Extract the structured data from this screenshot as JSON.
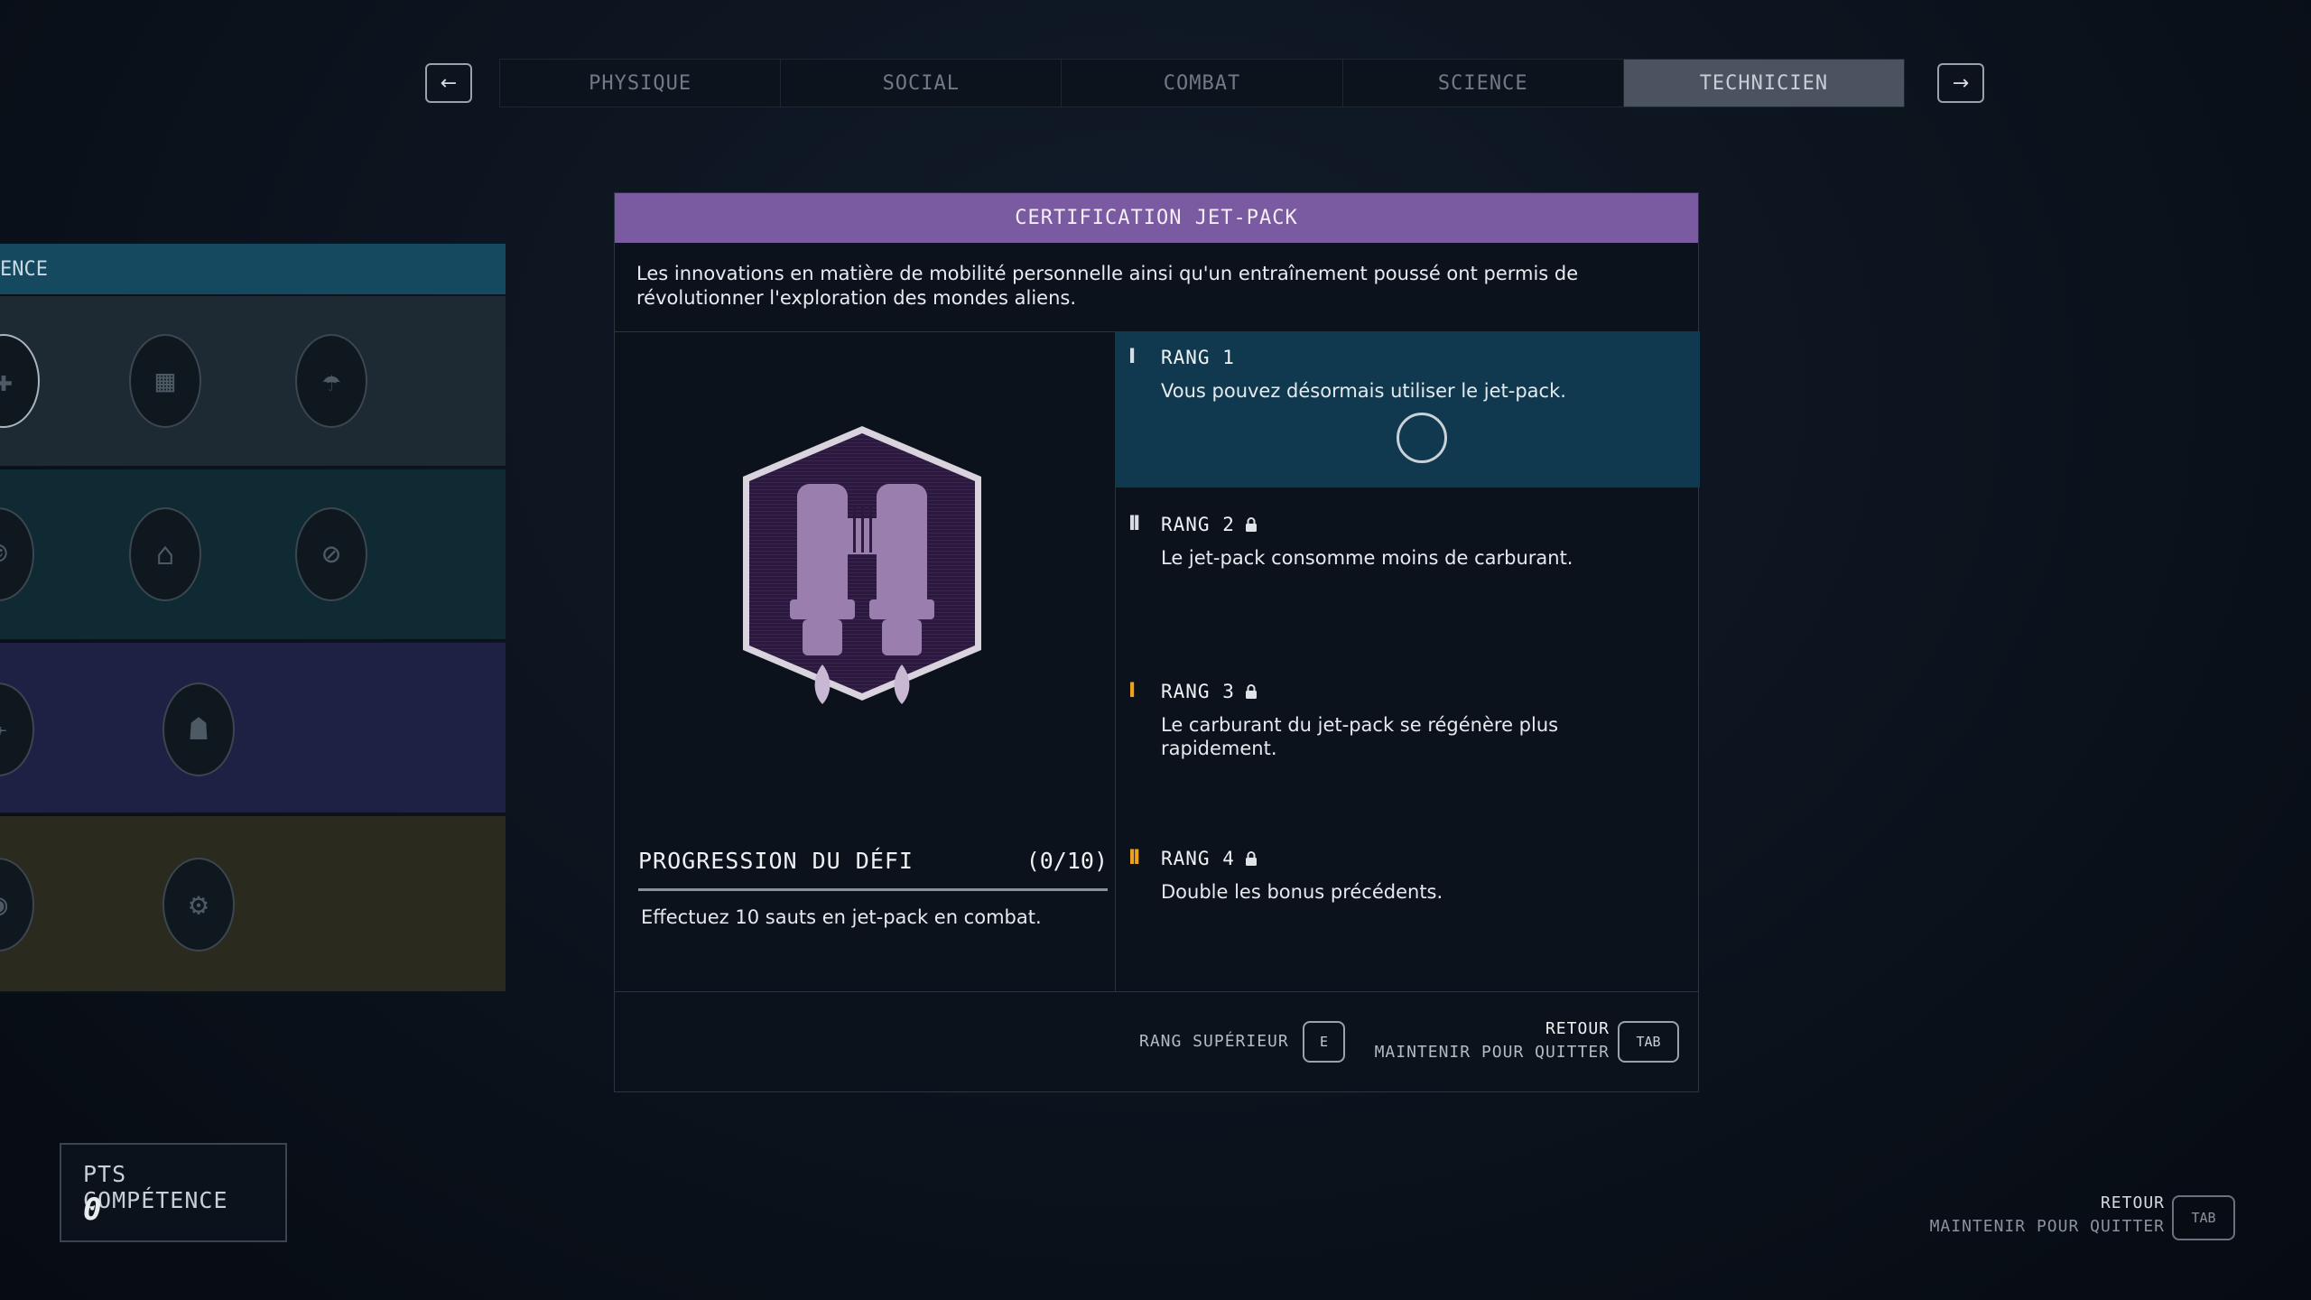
{
  "nav": {
    "prev_icon": "arrow-left-icon",
    "next_icon": "arrow-right-icon",
    "prev_glyph": "←",
    "next_glyph": "→",
    "tabs": [
      {
        "label": "PHYSIQUE",
        "active": false
      },
      {
        "label": "SOCIAL",
        "active": false
      },
      {
        "label": "COMBAT",
        "active": false
      },
      {
        "label": "SCIENCE",
        "active": false
      },
      {
        "label": "TECHNICIEN",
        "active": true
      }
    ]
  },
  "tree": {
    "header": "ENCE",
    "row_colors": [
      "#1e2a33",
      "#0f2a32",
      "#1e2044",
      "#2a2a1e"
    ]
  },
  "panel": {
    "title": "CERTIFICATION JET-PACK",
    "title_color": "#7a5aa0",
    "description": "Les innovations en matière de mobilité personnelle ainsi qu'un entraînement poussé ont permis de révolutionner l'exploration des mondes aliens.",
    "badge_icon": "jetpack-badge-icon",
    "progress": {
      "title": "PROGRESSION DU DÉFI",
      "count": "(0/10)",
      "fraction": 0,
      "description": "Effectuez 10 sauts en jet-pack en combat."
    },
    "ranks": [
      {
        "marks": "I",
        "label": "RANG 1",
        "locked": false,
        "active": true,
        "desc": "Vous pouvez désormais utiliser le jet-pack."
      },
      {
        "marks": "II",
        "label": "RANG 2",
        "locked": true,
        "active": false,
        "desc": "Le jet-pack consomme moins de carburant."
      },
      {
        "marks": "I",
        "label": "RANG 3",
        "locked": true,
        "active": false,
        "desc": "Le carburant du jet-pack se régénère plus rapidement."
      },
      {
        "marks": "II",
        "label": "RANG 4",
        "locked": true,
        "active": false,
        "desc": "Double les bonus précédents."
      }
    ],
    "rank_mark_colors": [
      "#d8dde2",
      "#d8dde2",
      "#f0a21e",
      "#f0a21e"
    ],
    "footer": {
      "upgrade_label": "RANG SUPÉRIEUR",
      "upgrade_key": "E",
      "back_label": "RETOUR",
      "hold_label": "MAINTENIR POUR QUITTER",
      "back_key": "TAB"
    }
  },
  "skill_points": {
    "label": "PTS COMPÉTENCE",
    "value": "0"
  },
  "global_footer": {
    "back_label": "RETOUR",
    "hold_label": "MAINTENIR POUR QUITTER",
    "back_key": "TAB"
  }
}
